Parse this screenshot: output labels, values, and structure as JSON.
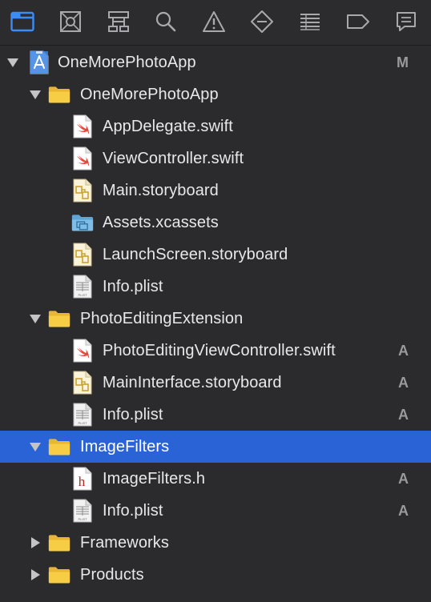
{
  "toolbar": {
    "icons": [
      {
        "name": "project-navigator-icon",
        "active": true
      },
      {
        "name": "source-control-navigator-icon",
        "active": false
      },
      {
        "name": "symbol-navigator-icon",
        "active": false
      },
      {
        "name": "find-navigator-icon",
        "active": false
      },
      {
        "name": "issue-navigator-icon",
        "active": false
      },
      {
        "name": "test-navigator-icon",
        "active": false
      },
      {
        "name": "debug-navigator-icon",
        "active": false
      },
      {
        "name": "breakpoint-navigator-icon",
        "active": false
      },
      {
        "name": "report-navigator-icon",
        "active": false
      }
    ]
  },
  "colors": {
    "accent": "#2a63d6",
    "active_icon": "#3b8cf5",
    "inactive_icon": "#a8a8ad",
    "background": "#2b2b2d",
    "status_text": "#9a9a9e"
  },
  "tree": [
    {
      "label": "OneMorePhotoApp",
      "status": "M",
      "icon": "xcode-project-icon",
      "level": 0,
      "disclosure": "expanded",
      "selected": false
    },
    {
      "label": "OneMorePhotoApp",
      "status": "",
      "icon": "folder-icon",
      "level": 1,
      "disclosure": "expanded",
      "selected": false
    },
    {
      "label": "AppDelegate.swift",
      "status": "",
      "icon": "swift-file-icon",
      "level": 2,
      "disclosure": "none",
      "selected": false
    },
    {
      "label": "ViewController.swift",
      "status": "",
      "icon": "swift-file-icon",
      "level": 2,
      "disclosure": "none",
      "selected": false
    },
    {
      "label": "Main.storyboard",
      "status": "",
      "icon": "storyboard-file-icon",
      "level": 2,
      "disclosure": "none",
      "selected": false
    },
    {
      "label": "Assets.xcassets",
      "status": "",
      "icon": "asset-catalog-icon",
      "level": 2,
      "disclosure": "none",
      "selected": false
    },
    {
      "label": "LaunchScreen.storyboard",
      "status": "",
      "icon": "storyboard-file-icon",
      "level": 2,
      "disclosure": "none",
      "selected": false
    },
    {
      "label": "Info.plist",
      "status": "",
      "icon": "plist-file-icon",
      "level": 2,
      "disclosure": "none",
      "selected": false
    },
    {
      "label": "PhotoEditingExtension",
      "status": "",
      "icon": "folder-icon",
      "level": 1,
      "disclosure": "expanded",
      "selected": false
    },
    {
      "label": "PhotoEditingViewController.swift",
      "status": "A",
      "icon": "swift-file-icon",
      "level": 2,
      "disclosure": "none",
      "selected": false
    },
    {
      "label": "MainInterface.storyboard",
      "status": "A",
      "icon": "storyboard-file-icon",
      "level": 2,
      "disclosure": "none",
      "selected": false
    },
    {
      "label": "Info.plist",
      "status": "A",
      "icon": "plist-file-icon",
      "level": 2,
      "disclosure": "none",
      "selected": false
    },
    {
      "label": "ImageFilters",
      "status": "",
      "icon": "folder-icon",
      "level": 1,
      "disclosure": "expanded",
      "selected": true
    },
    {
      "label": "ImageFilters.h",
      "status": "A",
      "icon": "header-file-icon",
      "level": 2,
      "disclosure": "none",
      "selected": false
    },
    {
      "label": "Info.plist",
      "status": "A",
      "icon": "plist-file-icon",
      "level": 2,
      "disclosure": "none",
      "selected": false
    },
    {
      "label": "Frameworks",
      "status": "",
      "icon": "folder-icon",
      "level": 1,
      "disclosure": "collapsed",
      "selected": false
    },
    {
      "label": "Products",
      "status": "",
      "icon": "folder-icon",
      "level": 1,
      "disclosure": "collapsed",
      "selected": false
    }
  ]
}
